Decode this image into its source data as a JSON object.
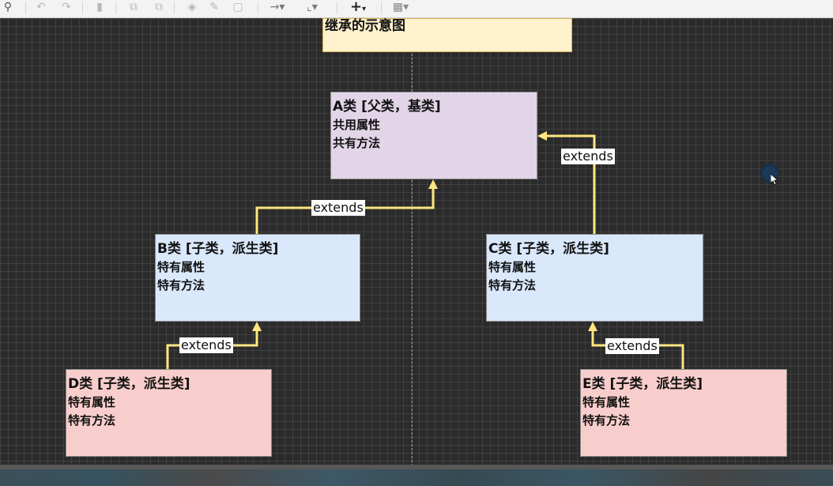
{
  "diagram": {
    "title": "继承的示意图",
    "node_a": {
      "title": "A类 [父类，基类]",
      "line1": "共用属性",
      "line2": "共有方法",
      "fill": "#e1d5e7"
    },
    "node_b": {
      "title": "B类 [子类，派生类]",
      "line1": "特有属性",
      "line2": "特有方法",
      "fill": "#dae8fc"
    },
    "node_c": {
      "title": "C类 [子类，派生类]",
      "line1": "特有属性",
      "line2": "特有方法",
      "fill": "#dae8fc"
    },
    "node_d": {
      "title": "D类 [子类，派生类]",
      "line1": "特有属性",
      "line2": "特有方法",
      "fill": "#f8cecc"
    },
    "node_e": {
      "title": "E类 [子类，派生类]",
      "line1": "特有属性",
      "line2": "特有方法",
      "fill": "#f8cecc"
    },
    "edge_labels": {
      "b_to_a": "extends",
      "c_to_a": "extends",
      "d_to_b": "extends",
      "e_to_c": "extends"
    },
    "edge_color": "#ffe680"
  },
  "toolbar": {
    "icons": [
      "zoom-out-icon",
      "undo-icon",
      "redo-icon",
      "delete-icon",
      "to-front-icon",
      "to-back-icon",
      "fill-color-icon",
      "line-color-icon",
      "shadow-icon",
      "connection-icon",
      "waypoints-icon",
      "insert-icon",
      "table-icon"
    ]
  }
}
